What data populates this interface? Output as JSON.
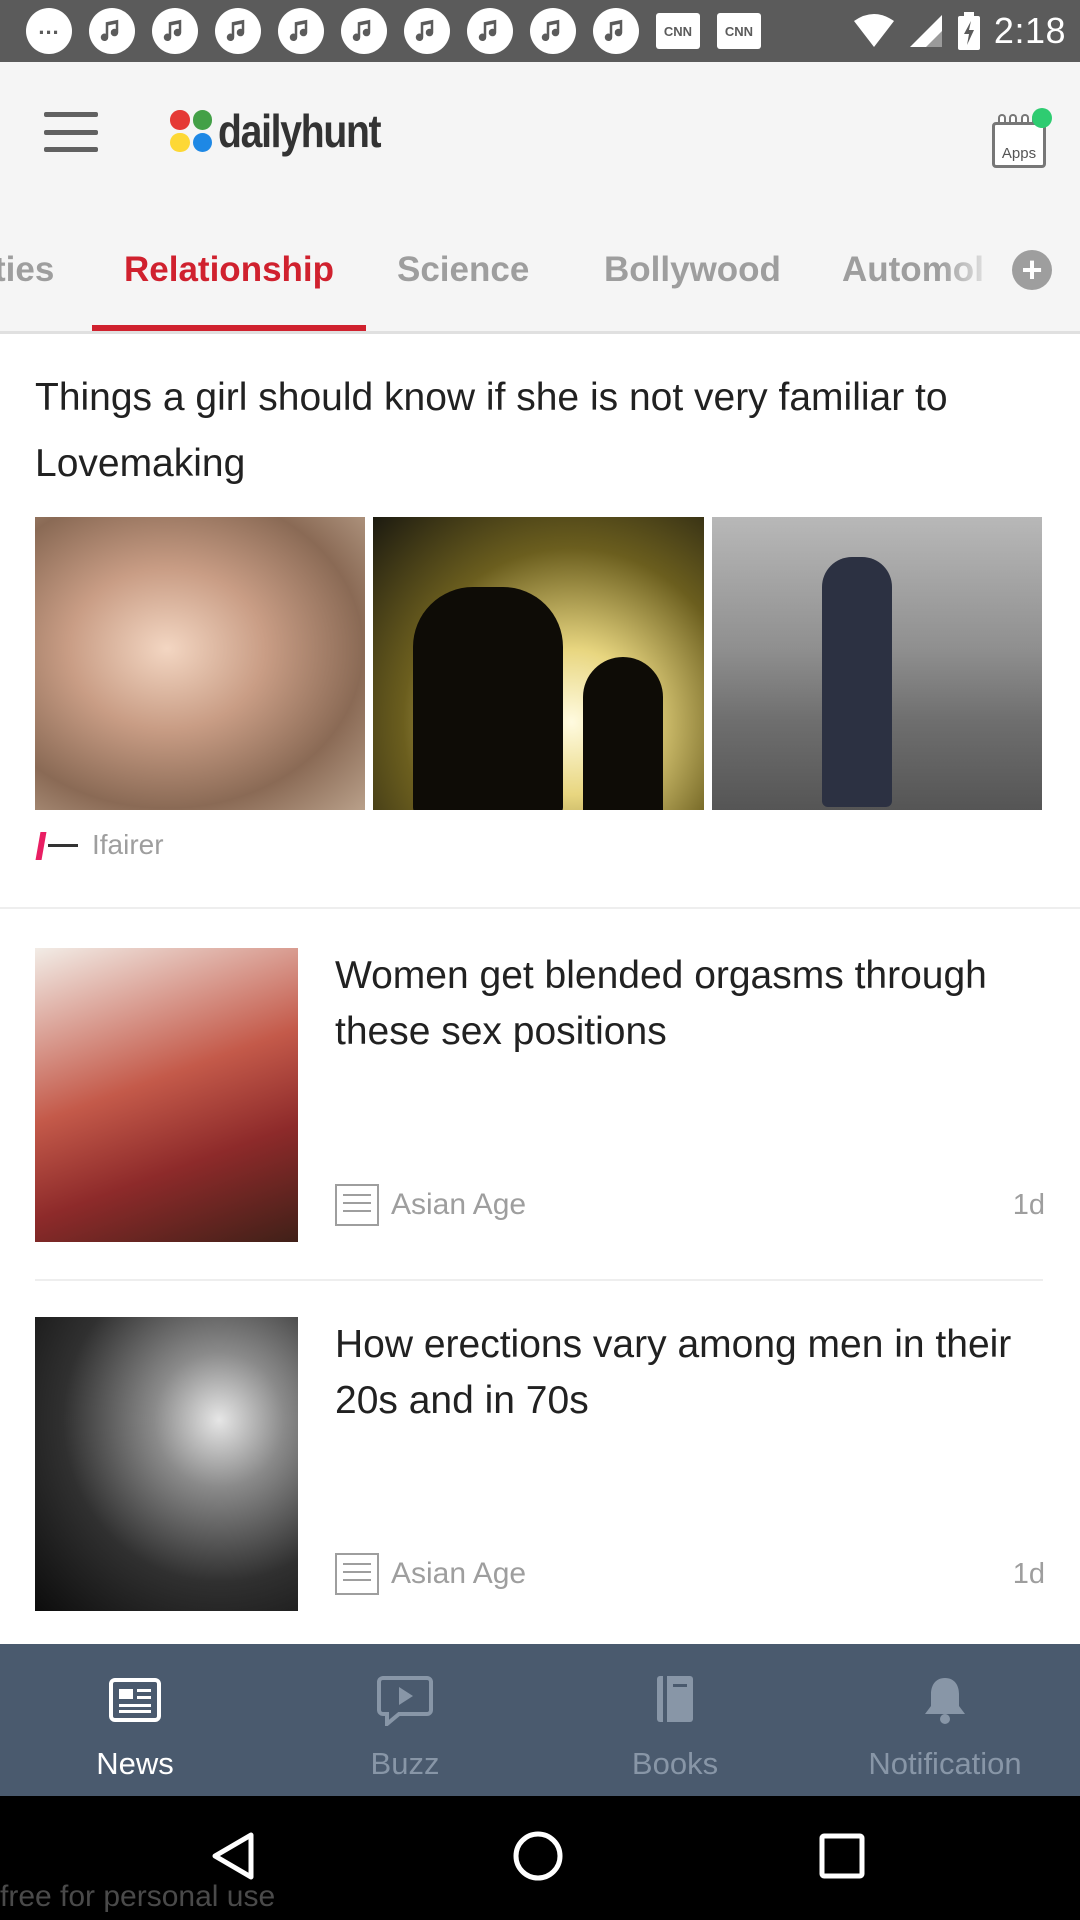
{
  "status_bar": {
    "time": "2:18",
    "notification_icons": [
      "chat-bubble-icon",
      "music-note-icon",
      "music-note-icon",
      "music-note-icon",
      "music-note-icon",
      "music-note-icon",
      "music-note-icon",
      "music-note-icon",
      "music-note-icon",
      "music-note-icon"
    ],
    "cnn_badges": [
      "CNN",
      "CNN"
    ]
  },
  "app_bar": {
    "logo_text": "dailyhunt",
    "apps_label": "Apps",
    "logo_colors": [
      "#e53935",
      "#fdd835",
      "#43a047",
      "#1e88e5"
    ]
  },
  "tabs": {
    "items": [
      "ties",
      "Relationship",
      "Science",
      "Bollywood",
      "Automol"
    ],
    "active_index": 1,
    "accent_color": "#d0212e"
  },
  "feed": {
    "featured": {
      "title": "Things a girl should know if she is not very familiar to Lovemaking",
      "source": "Ifairer",
      "source_logo_text": "ifairer"
    },
    "stories": [
      {
        "title": "Women get blended orgasms through these sex positions",
        "source": "Asian Age",
        "age": "1d"
      },
      {
        "title": "How erections vary among men in their 20s and in 70s",
        "source": "Asian Age",
        "age": "1d"
      }
    ]
  },
  "bottom_nav": {
    "items": [
      {
        "label": "News",
        "icon": "newspaper-icon"
      },
      {
        "label": "Buzz",
        "icon": "play-bubble-icon"
      },
      {
        "label": "Books",
        "icon": "book-icon"
      },
      {
        "label": "Notification",
        "icon": "bell-icon"
      }
    ],
    "active_index": 0
  },
  "system_nav": {
    "buttons": [
      "back-icon",
      "home-icon",
      "recents-icon"
    ]
  },
  "watermark": "free for personal use"
}
